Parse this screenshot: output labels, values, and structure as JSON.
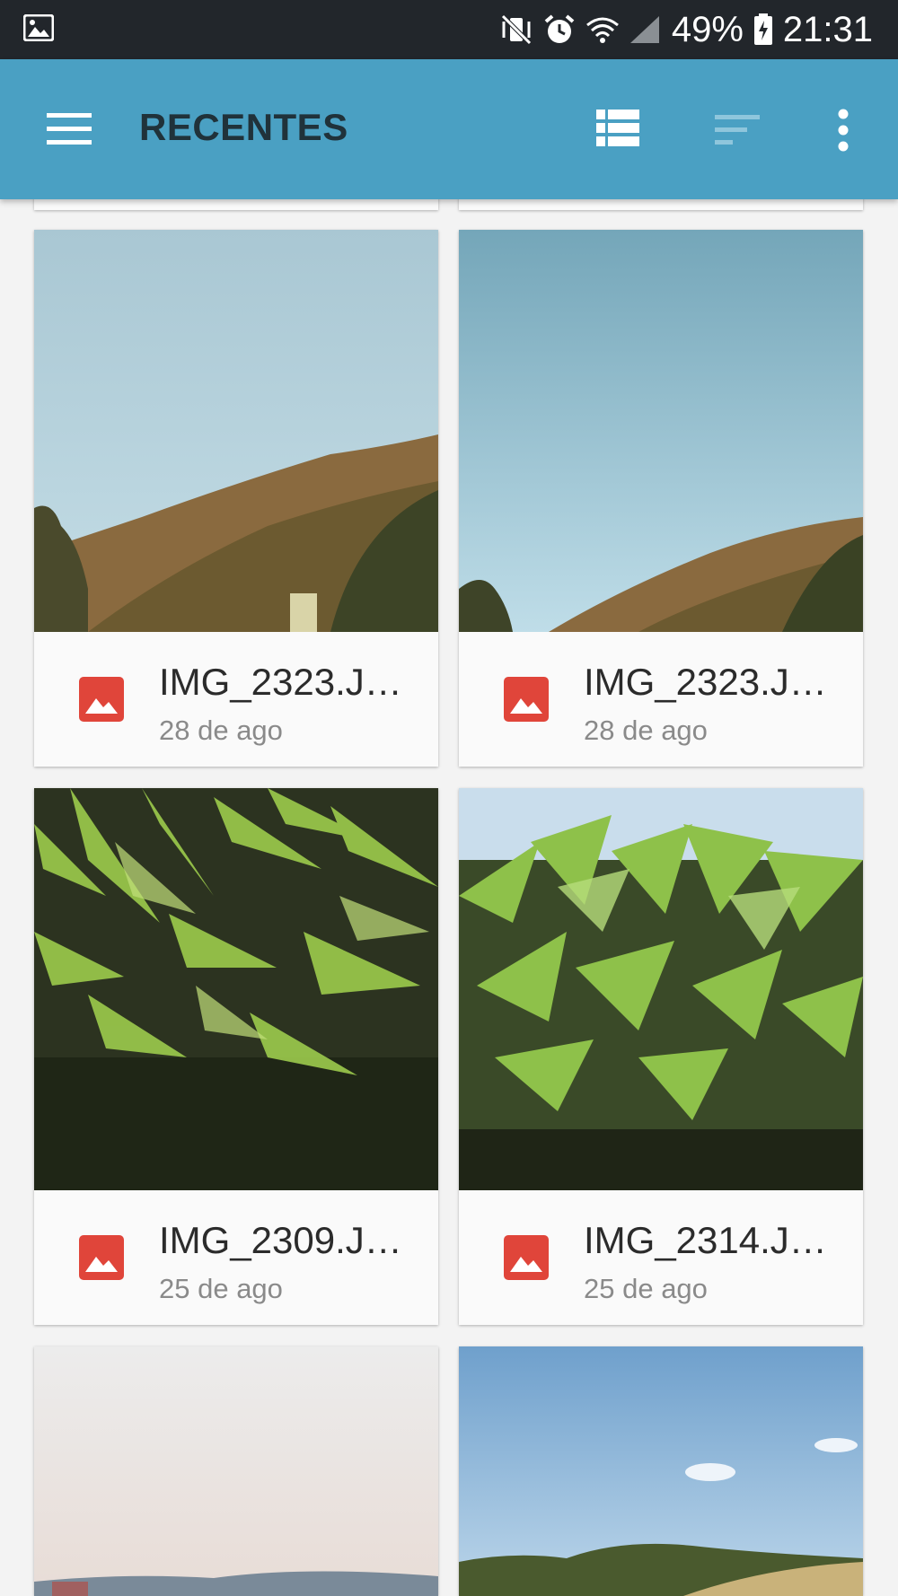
{
  "status_bar": {
    "battery": "49%",
    "time": "21:31",
    "icons": [
      "gallery-notification-icon",
      "vibrate-mute-icon",
      "alarm-icon",
      "wifi-icon",
      "signal-icon",
      "battery-icon"
    ]
  },
  "app_bar": {
    "title": "RECENTES",
    "icons": [
      "menu-icon",
      "list-view-icon",
      "sort-icon",
      "more-vert-icon"
    ],
    "color": "#4aa0c3"
  },
  "files": [
    {
      "name": "IMG_2323.J…",
      "date": "28 de ago",
      "icon": "image-file-icon"
    },
    {
      "name": "IMG_2323.J…",
      "date": "28 de ago",
      "icon": "image-file-icon"
    },
    {
      "name": "IMG_2309.J…",
      "date": "25 de ago",
      "icon": "image-file-icon"
    },
    {
      "name": "IMG_2314.J…",
      "date": "25 de ago",
      "icon": "image-file-icon"
    }
  ],
  "colors": {
    "file_icon": "#e0453a",
    "title_text": "#20323a"
  }
}
